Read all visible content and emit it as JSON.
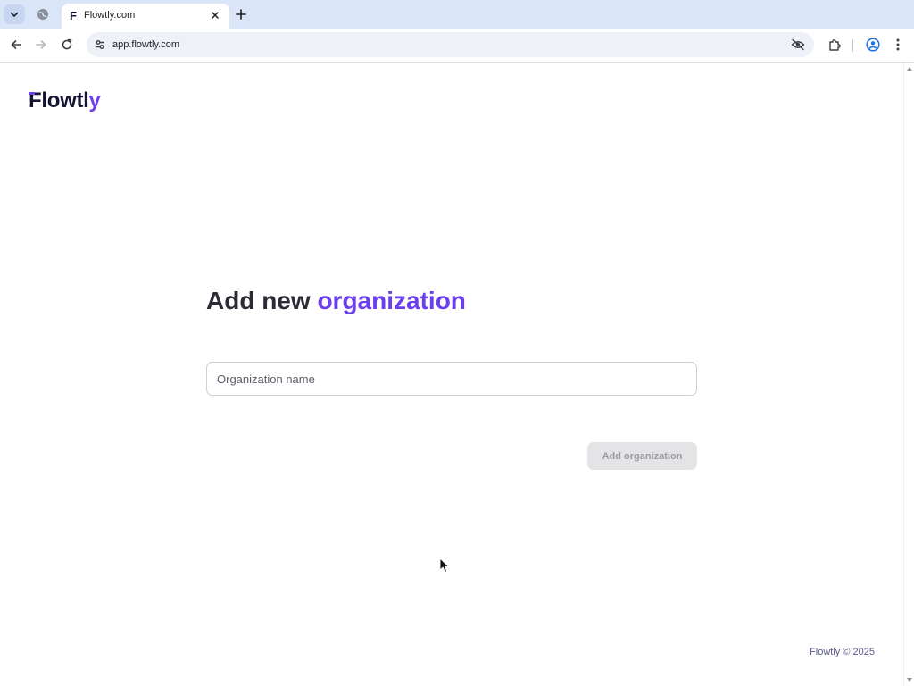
{
  "browser": {
    "tab": {
      "title": "Flowtly.com",
      "favicon_letter": "F"
    },
    "address": {
      "url": "app.flowtly.com"
    },
    "icons": {
      "tab_search": "chevron-down-icon",
      "inactive_tab": "globe-icon",
      "close_tab": "close-icon",
      "new_tab": "plus-icon",
      "back": "back-arrow-icon",
      "forward": "forward-arrow-icon",
      "reload": "reload-icon",
      "site_info": "tune-icon",
      "tracking": "eye-off-icon",
      "extensions": "puzzle-icon",
      "profile": "profile-icon",
      "menu": "kebab-menu-icon"
    }
  },
  "page": {
    "logo": {
      "first": "F",
      "middle": "lowtl",
      "last": "y"
    },
    "heading": {
      "prefix": "Add new ",
      "accent": "organization"
    },
    "form": {
      "name_placeholder": "Organization name",
      "name_value": "",
      "submit_label": "Add organization",
      "submit_disabled": true
    },
    "footer": "Flowtly © 2025"
  },
  "colors": {
    "brand_accent": "#6b3ef0",
    "brand_dark": "#151433",
    "heading_text": "#2b2b35",
    "disabled_button_bg": "#e4e4e6",
    "disabled_button_text": "#9a9aa2",
    "footer_text": "#5a5a8a",
    "chrome_tabbar": "#dae5f8"
  }
}
